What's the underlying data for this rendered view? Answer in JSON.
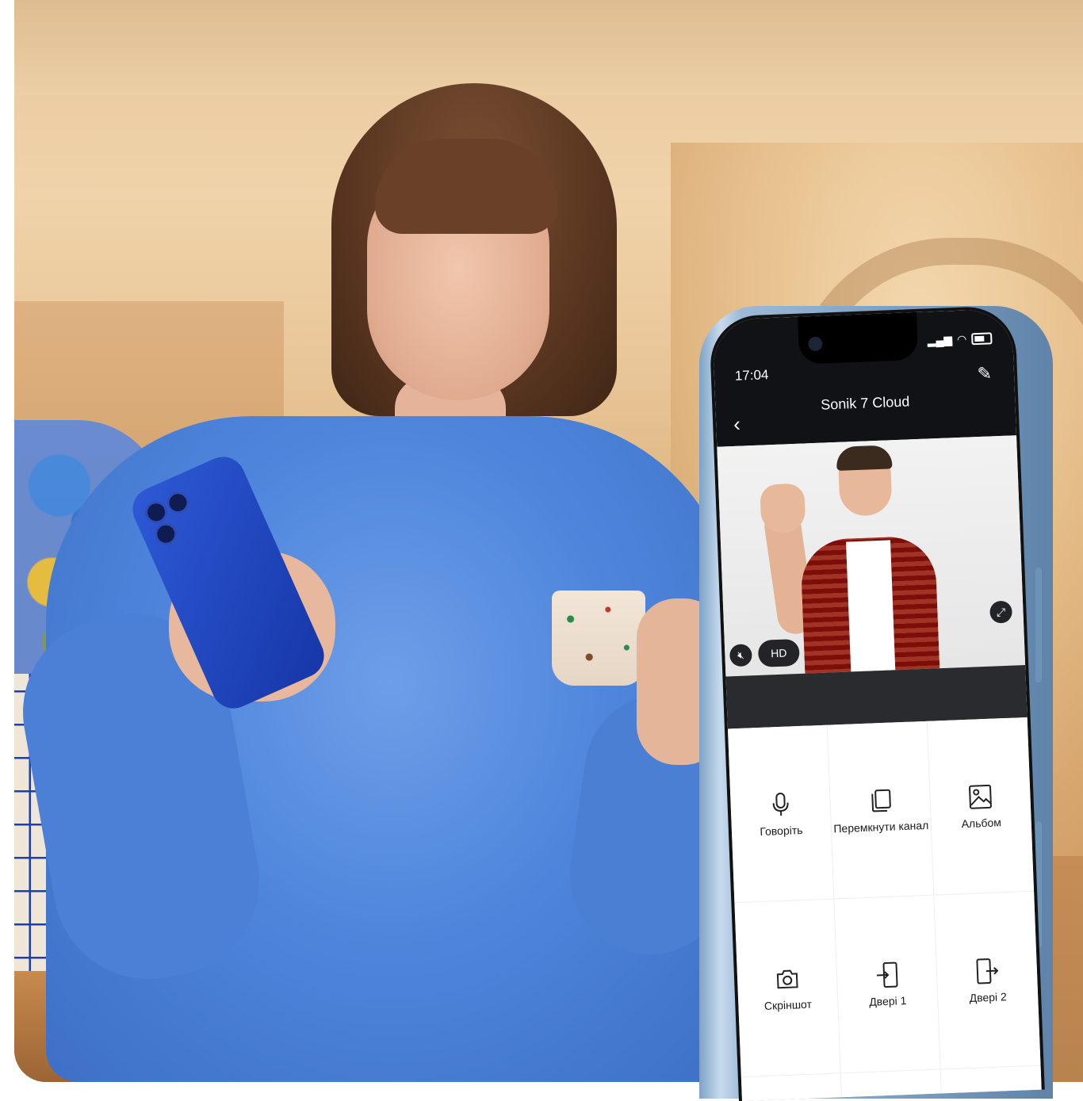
{
  "app": {
    "status_time": "17:04",
    "title": "Sonik 7 Cloud"
  },
  "video": {
    "quality_label": "HD"
  },
  "actions": [
    {
      "label": "Говоріть",
      "icon": "microphone-icon"
    },
    {
      "label": "Перемкнути канал",
      "icon": "switch-channel-icon"
    },
    {
      "label": "Альбом",
      "icon": "album-icon"
    },
    {
      "label": "Скріншот",
      "icon": "camera-icon"
    },
    {
      "label": "Двері 1",
      "icon": "door-icon"
    },
    {
      "label": "Двері 2",
      "icon": "door-icon"
    }
  ],
  "colors": {
    "header_bg": "#111216",
    "band_bg": "#2a2b2e",
    "phone_frame": "#7ea3c6"
  }
}
